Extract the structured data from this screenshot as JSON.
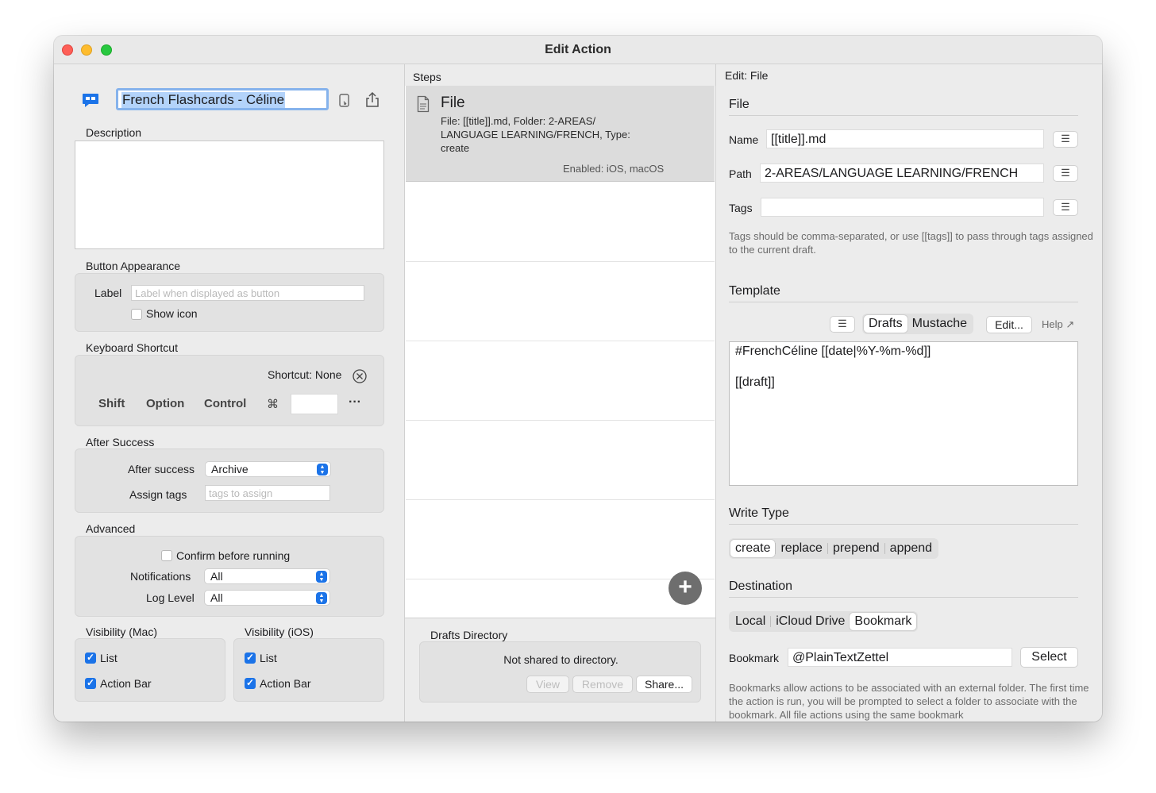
{
  "window": {
    "title": "Edit Action"
  },
  "left": {
    "action_name": "French Flashcards - Céline",
    "description_label": "Description",
    "description_value": "",
    "button_appearance": {
      "heading": "Button Appearance",
      "label_label": "Label",
      "label_placeholder": "Label when displayed as button",
      "show_icon": "Show icon",
      "show_icon_checked": false
    },
    "keyboard_shortcut": {
      "heading": "Keyboard Shortcut",
      "shortcut_text": "Shortcut: None",
      "modifiers": [
        "Shift",
        "Option",
        "Control",
        "⌘"
      ],
      "more": "···"
    },
    "after_success": {
      "heading": "After Success",
      "after_label": "After success",
      "after_value": "Archive",
      "tags_label": "Assign tags",
      "tags_placeholder": "tags to assign"
    },
    "advanced": {
      "heading": "Advanced",
      "confirm": "Confirm before running",
      "confirm_checked": false,
      "notifications_label": "Notifications",
      "notifications_value": "All",
      "log_label": "Log Level",
      "log_value": "All"
    },
    "visibility_mac": {
      "heading": "Visibility (Mac)",
      "list": "List",
      "action_bar": "Action Bar",
      "list_checked": true,
      "action_bar_checked": true
    },
    "visibility_ios": {
      "heading": "Visibility (iOS)",
      "list": "List",
      "action_bar": "Action Bar",
      "list_checked": true,
      "action_bar_checked": true
    }
  },
  "middle": {
    "heading": "Steps",
    "step": {
      "title": "File",
      "detail": "File: [[title]].md, Folder: 2-AREAS/ LANGUAGE LEARNING/FRENCH, Type: create",
      "enabled": "Enabled: iOS, macOS"
    },
    "add_glyph": "+",
    "directory": {
      "heading": "Drafts Directory",
      "status": "Not shared to directory.",
      "view": "View",
      "remove": "Remove",
      "share": "Share..."
    }
  },
  "right": {
    "heading": "Edit: File",
    "file_section": "File",
    "name_label": "Name",
    "name_value": "[[title]].md",
    "path_label": "Path",
    "path_value": "2-AREAS/LANGUAGE LEARNING/FRENCH",
    "tags_label": "Tags",
    "tags_value": "",
    "tags_help": "Tags should be comma-separated, or use [[tags]] to pass through tags assigned to the current draft.",
    "template_section": "Template",
    "template_modes": [
      "Drafts",
      "Mustache"
    ],
    "template_edit": "Edit...",
    "template_help": "Help ↗",
    "template_line1": "#FrenchCéline [[date|%Y-%m-%d]]",
    "template_line2": "[[draft]]",
    "write_type_section": "Write Type",
    "write_types": [
      "create",
      "replace",
      "prepend",
      "append"
    ],
    "write_type_selected": "create",
    "destination_section": "Destination",
    "destinations": [
      "Local",
      "iCloud Drive",
      "Bookmark"
    ],
    "destination_selected": "Bookmark",
    "bookmark_label": "Bookmark",
    "bookmark_value": "@PlainTextZettel",
    "select_button": "Select",
    "bookmark_help": "Bookmarks allow actions to be associated with an external folder. The first time the action is run, you will be prompted to select a folder to associate with the bookmark. All file actions using the same bookmark"
  },
  "colors": {
    "accent": "#1b73e8",
    "window_bg": "#ececec",
    "group_bg": "#e2e2e2"
  }
}
